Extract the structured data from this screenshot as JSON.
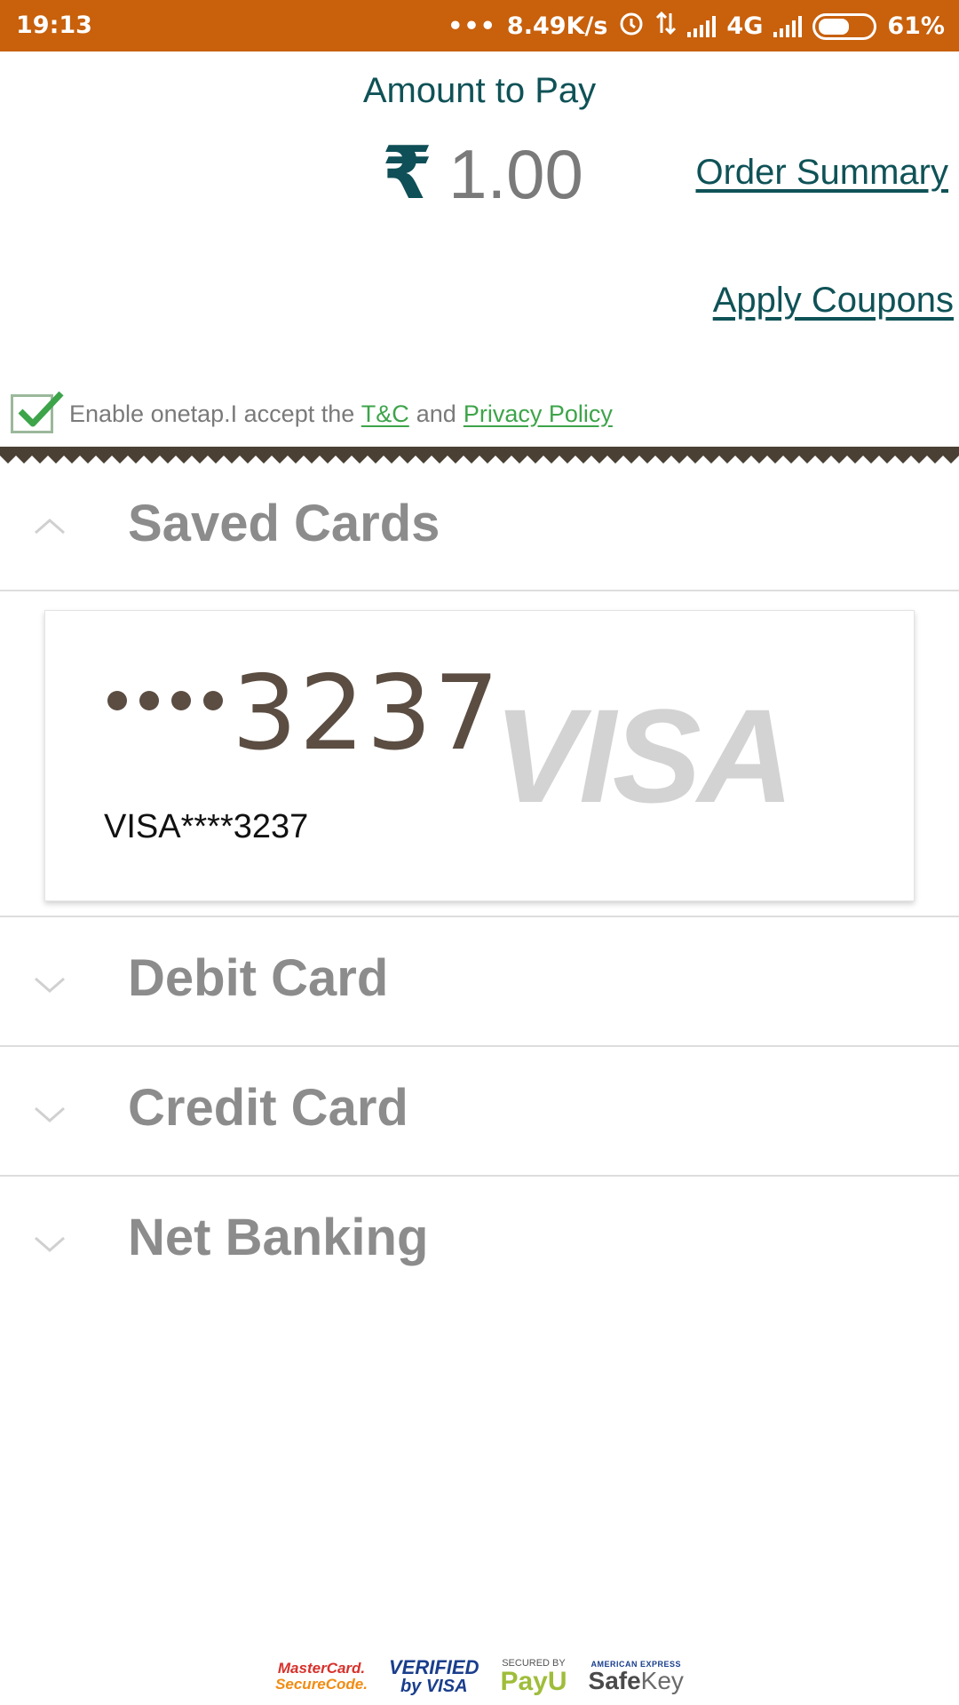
{
  "status_bar": {
    "time": "19:13",
    "speed": "8.49K/s",
    "network": "4G",
    "battery": "61%",
    "battery_level": 0.61,
    "icons": [
      "alarm-icon",
      "data-transfer-icon",
      "signal-icon",
      "signal-icon",
      "battery-icon"
    ]
  },
  "header": {
    "amount_label": "Amount to Pay",
    "currency_symbol": "₹",
    "amount": "1.00",
    "order_summary": "Order Summary",
    "apply_coupons": "Apply Coupons"
  },
  "onetap": {
    "checked": true,
    "text": "Enable onetap.I accept the",
    "tc_link": "T&C ",
    "and": "and",
    "privacy_link": " Privacy Policy"
  },
  "sections": {
    "saved_cards": {
      "title": "Saved Cards",
      "expanded": true
    },
    "debit_card": {
      "title": "Debit Card",
      "expanded": false
    },
    "credit_card": {
      "title": "Credit Card",
      "expanded": false
    },
    "net_banking": {
      "title": "Net Banking",
      "expanded": false
    }
  },
  "saved_card": {
    "masked_dots": "••••",
    "last_four": "3237",
    "brand_logo": "VISA",
    "label": "VISA****3237"
  },
  "footer": {
    "mastercard_line1": "MasterCard.",
    "mastercard_line2": "SecureCode.",
    "verified_line1": "VERIFIED",
    "verified_line2": "by VISA",
    "payu_secured": "SECURED BY",
    "payu_brand": "PayU",
    "amex_line1": "AMERICAN EXPRESS",
    "amex_safe": "Safe",
    "amex_key": "Key"
  },
  "colors": {
    "status_bar": "#c8600c",
    "accent_teal": "#0f5257",
    "link_green": "#3da44a",
    "section_title": "#8c8c8c",
    "card_digits": "#5b4d42",
    "divider_brown": "#4a4034"
  }
}
